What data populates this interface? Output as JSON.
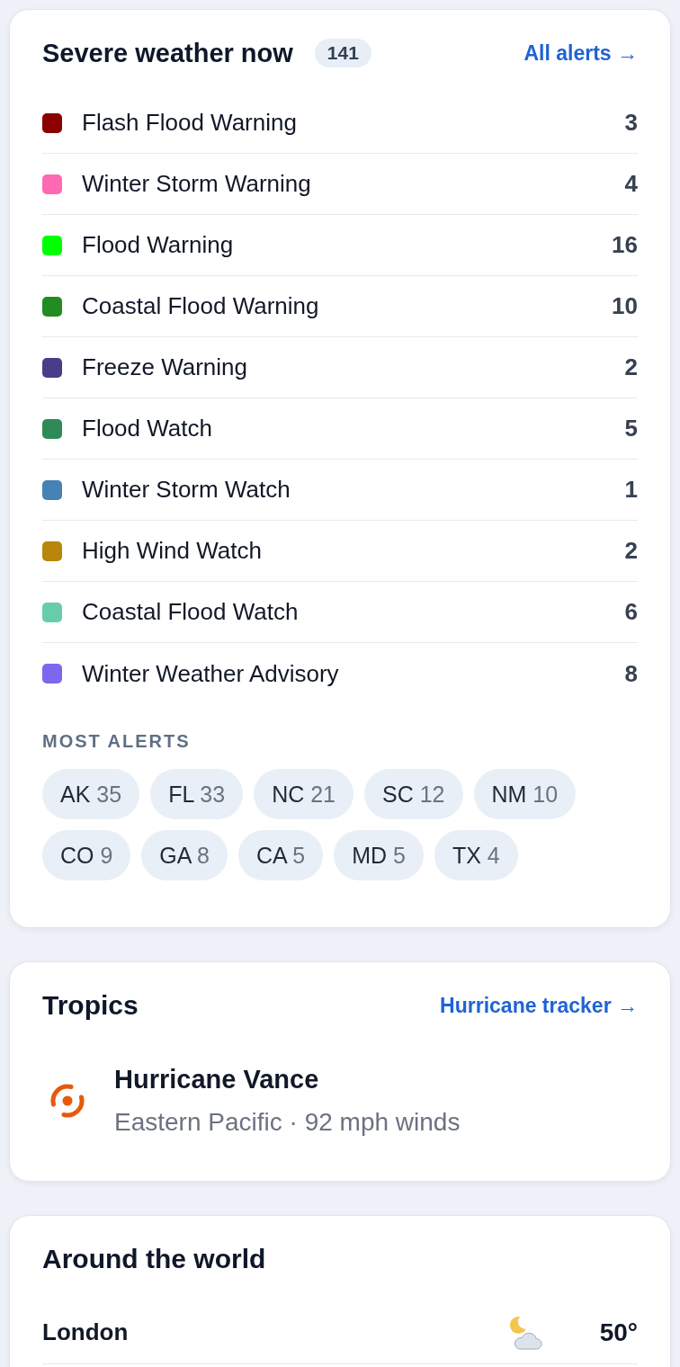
{
  "alerts_card": {
    "title": "Severe weather now",
    "total": "141",
    "link": "All alerts →",
    "alerts": [
      {
        "name": "Flash Flood Warning",
        "count": "3",
        "color": "#8b0000"
      },
      {
        "name": "Winter Storm Warning",
        "count": "4",
        "color": "#ff69b4"
      },
      {
        "name": "Flood Warning",
        "count": "16",
        "color": "#00ff00"
      },
      {
        "name": "Coastal Flood Warning",
        "count": "10",
        "color": "#228b22"
      },
      {
        "name": "Freeze Warning",
        "count": "2",
        "color": "#483d8b"
      },
      {
        "name": "Flood Watch",
        "count": "5",
        "color": "#2e8b57"
      },
      {
        "name": "Winter Storm Watch",
        "count": "1",
        "color": "#4682b4"
      },
      {
        "name": "High Wind Watch",
        "count": "2",
        "color": "#b8860b"
      },
      {
        "name": "Coastal Flood Watch",
        "count": "6",
        "color": "#66cdaa"
      },
      {
        "name": "Winter Weather Advisory",
        "count": "8",
        "color": "#7b68ee"
      }
    ],
    "states_heading": "MOST ALERTS",
    "states": [
      {
        "code": "AK",
        "count": "35"
      },
      {
        "code": "FL",
        "count": "33"
      },
      {
        "code": "NC",
        "count": "21"
      },
      {
        "code": "SC",
        "count": "12"
      },
      {
        "code": "NM",
        "count": "10"
      },
      {
        "code": "CO",
        "count": "9"
      },
      {
        "code": "GA",
        "count": "8"
      },
      {
        "code": "CA",
        "count": "5"
      },
      {
        "code": "MD",
        "count": "5"
      },
      {
        "code": "TX",
        "count": "4"
      }
    ]
  },
  "tropics_card": {
    "title": "Tropics",
    "link": "Hurricane tracker →",
    "storms": [
      {
        "name": "Hurricane Vance",
        "details": "Eastern Pacific · 92 mph winds"
      }
    ]
  },
  "world_card": {
    "title": "Around the world",
    "cities": [
      {
        "name": "London",
        "temperature": "50°"
      }
    ]
  }
}
